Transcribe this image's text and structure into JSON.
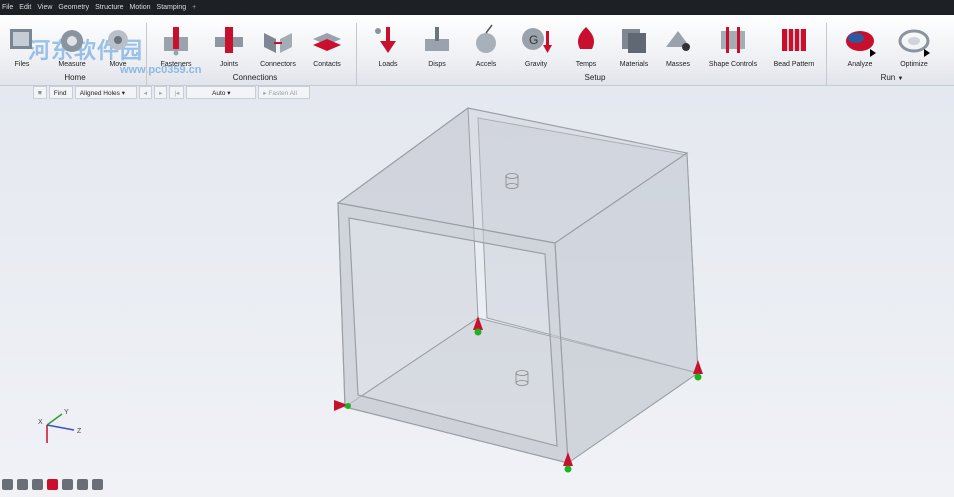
{
  "menu": [
    "File",
    "Edit",
    "View",
    "Geometry",
    "Structure",
    "Motion",
    "Stamping"
  ],
  "menu_plus": "+",
  "watermark": {
    "text": "河东软件园",
    "url": "www.pc0359.cn"
  },
  "ribbon": {
    "tools": {
      "files": "Files",
      "measure": "Measure",
      "move": "Move",
      "fasteners": "Fasteners",
      "joints": "Joints",
      "connectors": "Connectors",
      "contacts": "Contacts",
      "loads": "Loads",
      "disps": "Disps",
      "accels": "Accels",
      "gravity": "Gravity",
      "temps": "Temps",
      "materials": "Materials",
      "masses": "Masses",
      "shape_controls": "Shape Controls",
      "bead_pattern": "Bead Pattern",
      "analyze": "Analyze",
      "optimize": "Optimize"
    },
    "groups": {
      "home": "Home",
      "connections": "Connections",
      "setup": "Setup",
      "run": "Run"
    }
  },
  "subtoolbar": {
    "menu_icon": "≡",
    "find": "Find",
    "filter": "Aligned Holes ▾",
    "auto": "Auto ▾",
    "fasten_all": "Fasten All"
  },
  "axis": {
    "x": "X",
    "y": "Y",
    "z": "Z"
  },
  "colors": {
    "accent": "#c8102e",
    "ground": "#1db31d",
    "menubar": "#1d2024"
  }
}
